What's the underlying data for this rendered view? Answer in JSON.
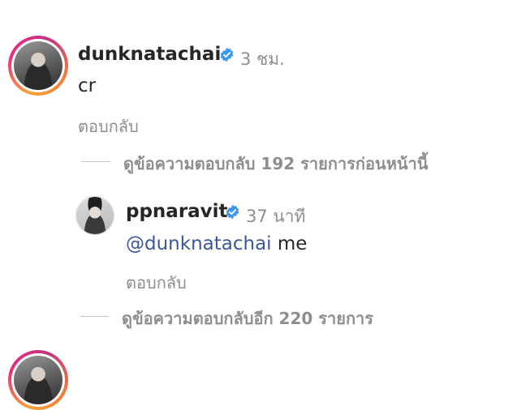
{
  "comment": {
    "username": "dunknatachai",
    "verified_icon": "verified-badge-icon",
    "time": "3 ชม.",
    "text": "cr",
    "reply_label": "ตอบกลับ",
    "view_previous_replies": "ดูข้อความตอบกลับ 192 รายการก่อนหน้านี้"
  },
  "reply": {
    "username": "ppnaravit",
    "verified_icon": "verified-badge-icon",
    "time": "37 นาที",
    "mention": "@dunknatachai",
    "text": " me",
    "reply_label": "ตอบกลับ",
    "view_more_replies": "ดูข้อความตอบกลับอีก 220 รายการ"
  },
  "colors": {
    "verified": "#3897f0",
    "mention": "#3b5998",
    "muted": "#8e8e8e",
    "story_ring": [
      "#f9a13a",
      "#ee2a7b",
      "#c13584"
    ]
  }
}
